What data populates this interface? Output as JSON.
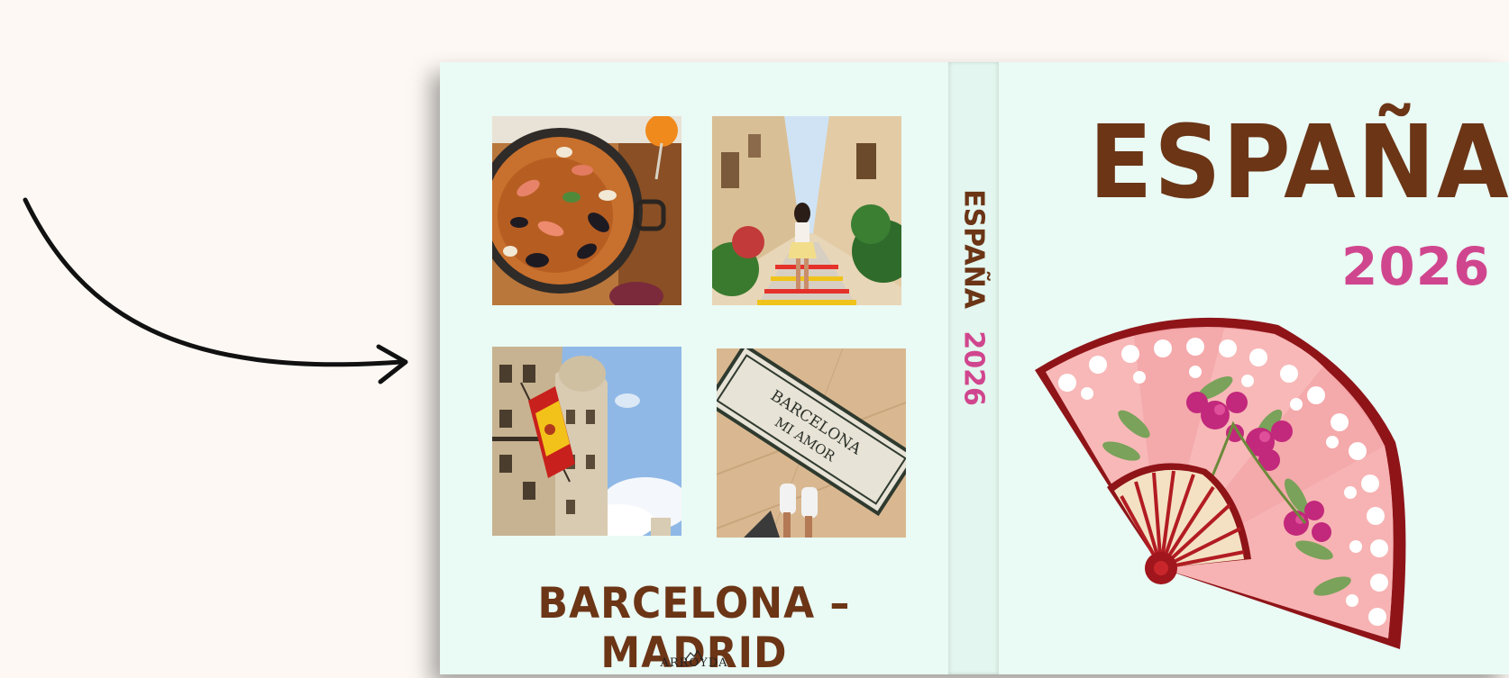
{
  "canvas": {
    "background": "#fdf8f3"
  },
  "arrow": {
    "icon": "curved-arrow-right-icon",
    "color": "#111111"
  },
  "book": {
    "cover_color": "#eafaf4",
    "back": {
      "photos": [
        {
          "name": "paella-photo",
          "description_icon": "paella-icon"
        },
        {
          "name": "street-stairs-photo",
          "description_icon": "street-icon"
        },
        {
          "name": "flag-building-photo",
          "description_icon": "flag-icon"
        },
        {
          "name": "mosaic-sign-photo",
          "sign_line1": "BARCELONA",
          "sign_line2": "MI AMOR"
        }
      ],
      "title": "BARCELONA – MADRID",
      "title_color": "#6b3516",
      "logo_text": "ARROYDA"
    },
    "spine": {
      "word": "ESPAÑA",
      "year": "2026",
      "word_color": "#6b3516",
      "year_color": "#d0468e"
    },
    "front": {
      "title": "ESPAÑA",
      "year": "2026",
      "title_color": "#6b3516",
      "year_color": "#d0468e",
      "illustration_icon": "hand-fan-icon"
    }
  }
}
